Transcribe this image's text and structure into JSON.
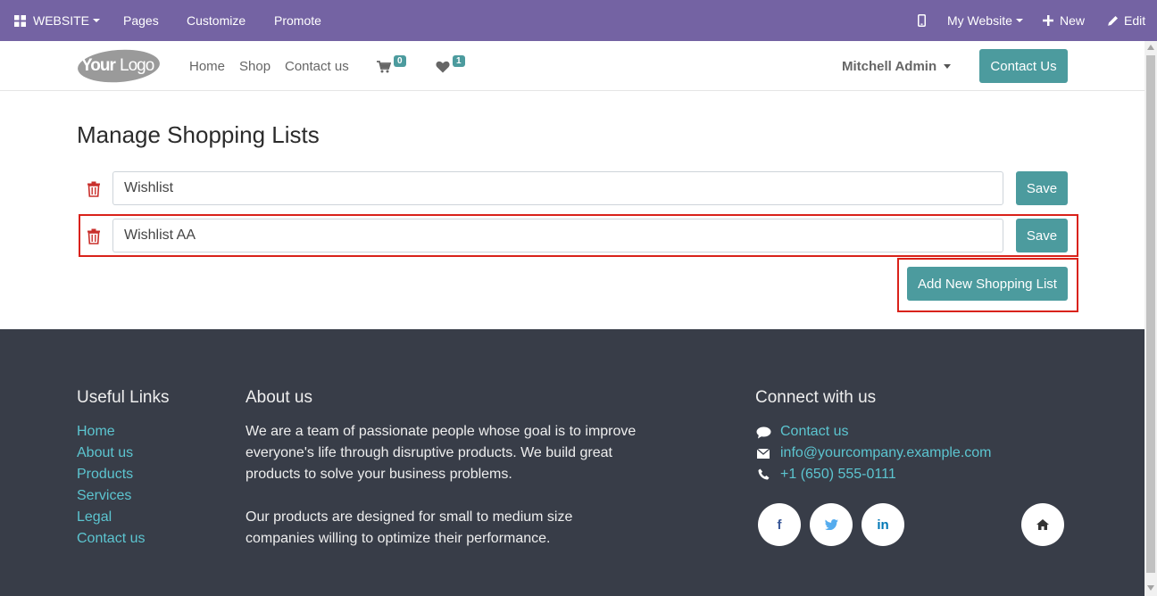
{
  "adminbar": {
    "website_label": "WEBSITE",
    "pages_label": "Pages",
    "customize_label": "Customize",
    "promote_label": "Promote",
    "my_website_label": "My Website",
    "new_label": "New",
    "edit_label": "Edit"
  },
  "header": {
    "logo_text": "YourLogo",
    "nav": [
      "Home",
      "Shop",
      "Contact us"
    ],
    "cart_count": "0",
    "wishlist_count": "1",
    "user_name": "Mitchell Admin",
    "contact_button": "Contact Us"
  },
  "main": {
    "title": "Manage Shopping Lists",
    "lists": [
      {
        "name": "Wishlist",
        "save_label": "Save"
      },
      {
        "name": "Wishlist AA",
        "save_label": "Save"
      }
    ],
    "add_button": "Add New Shopping List"
  },
  "footer": {
    "useful_links_title": "Useful Links",
    "useful_links": [
      "Home",
      "About us",
      "Products",
      "Services",
      "Legal",
      "Contact us"
    ],
    "about_title": "About us",
    "about_lines_1": [
      "We are a team of passionate people whose goal is to improve",
      "everyone's life through disruptive products. We build great",
      "products to solve your business problems."
    ],
    "about_lines_2": [
      "Our products are designed for small to medium size",
      "companies willing to optimize their performance."
    ],
    "connect_title": "Connect with us",
    "connect_contact": "Contact us",
    "connect_email": "info@yourcompany.example.com",
    "connect_phone": "+1 (650) 555-0111",
    "social": {
      "facebook": "f",
      "linkedin": "in"
    }
  },
  "colors": {
    "accent": "#4c9b9e",
    "admin_bar": "#7463a3",
    "footer_bg": "#383d48",
    "link": "#5cc5d0",
    "highlight": "#d9221a"
  }
}
